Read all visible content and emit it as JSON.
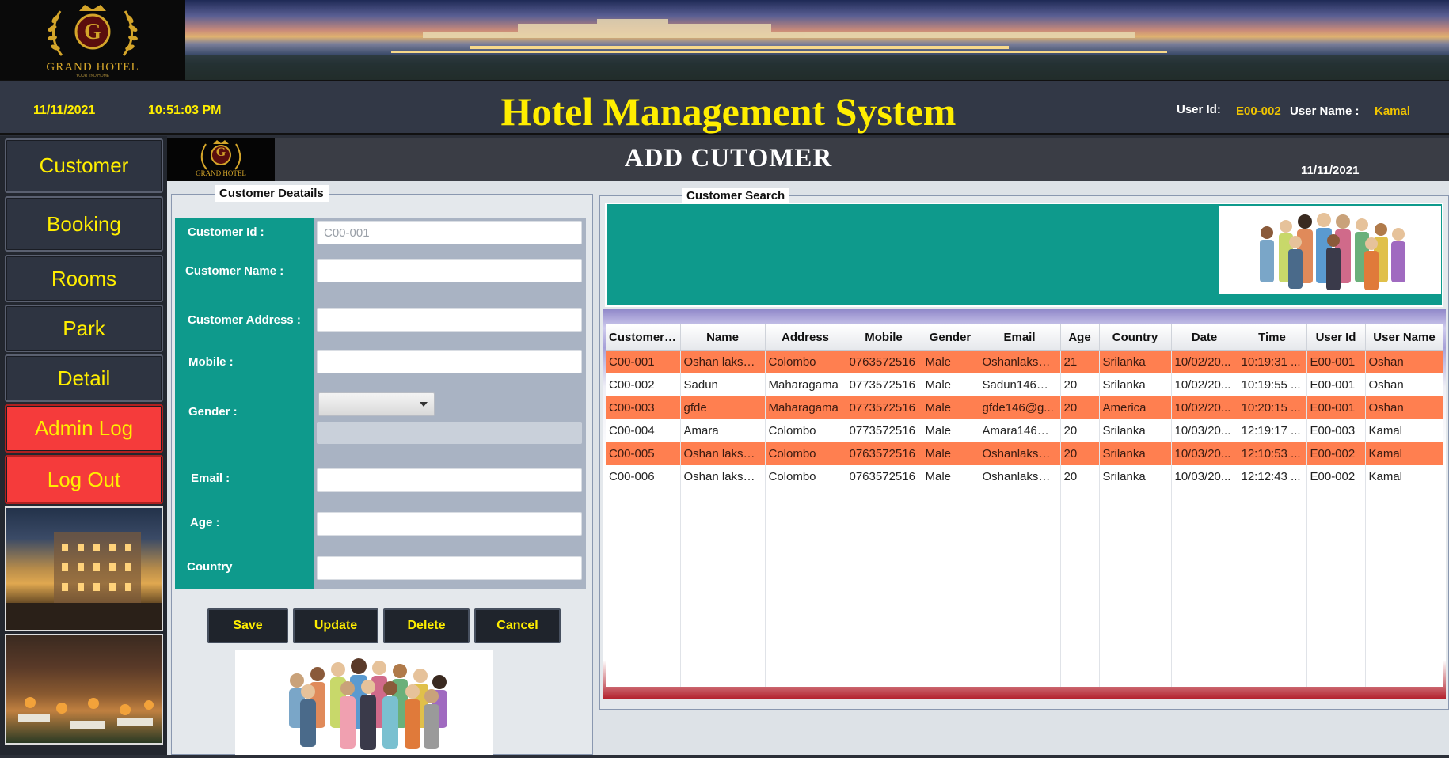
{
  "brand": {
    "logo_letter": "G",
    "logo_text": "GRAND HOTEL",
    "logo_tagline": "YOUR 2ND HOME"
  },
  "header": {
    "date": "11/11/2021",
    "time": "10:51:03 PM",
    "title": "Hotel Management System",
    "user_id_label": "User Id:",
    "user_id": "E00-002",
    "user_name_label": "User Name :",
    "user_name": "Kamal"
  },
  "sidebar": {
    "items": [
      {
        "label": "Customer"
      },
      {
        "label": "Booking"
      },
      {
        "label": "Rooms"
      },
      {
        "label": "Park"
      },
      {
        "label": "Detail"
      },
      {
        "label": "Admin Log"
      },
      {
        "label": "Log Out"
      }
    ]
  },
  "page": {
    "title": "ADD CUTOMER",
    "date": "11/11/2021"
  },
  "details": {
    "group_title": "Customer Deatails",
    "labels": {
      "customer_id": "Customer Id :",
      "customer_name": "Customer Name :",
      "customer_address": "Customer Address :",
      "mobile": "Mobile :",
      "gender": "Gender :",
      "email": "Email :",
      "age": "Age :",
      "country": "Country"
    },
    "values": {
      "customer_id_placeholder": "C00-001",
      "customer_name": "",
      "customer_address": "",
      "mobile": "",
      "gender": "",
      "email": "",
      "age": "",
      "country": ""
    },
    "buttons": {
      "save": "Save",
      "update": "Update",
      "delete": "Delete",
      "cancel": "Cancel"
    }
  },
  "search": {
    "group_title": "Customer Search",
    "table": {
      "columns": [
        "Customer Id",
        "Name",
        "Address",
        "Mobile",
        "Gender",
        "Email",
        "Age",
        "Country",
        "Date",
        "Time",
        "User Id",
        "User Name"
      ],
      "rows": [
        [
          "C00-001",
          "Oshan lakshi...",
          "Colombo",
          "0763572516",
          "Male",
          "Oshanlakshi...",
          "21",
          "Srilanka",
          "10/02/20...",
          "10:19:31 ...",
          "E00-001",
          "Oshan"
        ],
        [
          "C00-002",
          "Sadun",
          "Maharagama",
          "0773572516",
          "Male",
          "Sadun146@...",
          "20",
          "Srilanka",
          "10/02/20...",
          "10:19:55 ...",
          "E00-001",
          "Oshan"
        ],
        [
          "C00-003",
          "gfde",
          "Maharagama",
          "0773572516",
          "Male",
          "gfde146@g...",
          "20",
          "America",
          "10/02/20...",
          "10:20:15 ...",
          "E00-001",
          "Oshan"
        ],
        [
          "C00-004",
          "Amara",
          "Colombo",
          "0773572516",
          "Male",
          "Amara146@...",
          "20",
          "Srilanka",
          "10/03/20...",
          "12:19:17 ...",
          "E00-003",
          "Kamal"
        ],
        [
          "C00-005",
          "Oshan lakshi...",
          "Colombo",
          "0763572516",
          "Male",
          "Oshanlakshi...",
          "20",
          "Srilanka",
          "10/03/20...",
          "12:10:53 ...",
          "E00-002",
          "Kamal"
        ],
        [
          "C00-006",
          "Oshan lakshi...",
          "Colombo",
          "0763572516",
          "Male",
          "Oshanlakshi...",
          "20",
          "Srilanka",
          "10/03/20...",
          "12:12:43 ...",
          "E00-002",
          "Kamal"
        ]
      ],
      "highlighted_rows": [
        0,
        2,
        4
      ]
    }
  },
  "colors": {
    "accent_yellow": "#ffee00",
    "teal": "#0e9a8c",
    "row_highlight": "#ff7f50",
    "danger_red": "#f53b3b",
    "dark": "#2e3441"
  }
}
